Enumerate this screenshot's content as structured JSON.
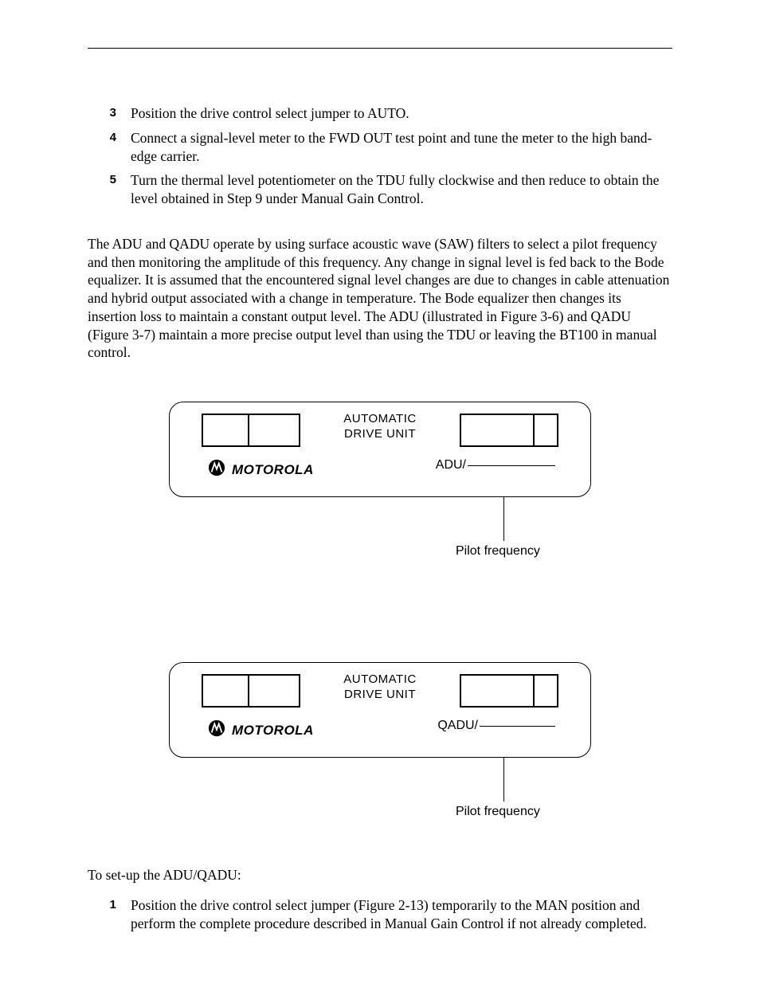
{
  "steps_a": [
    {
      "n": "3",
      "text": "Position the drive control select jumper to AUTO."
    },
    {
      "n": "4",
      "text": "Connect a signal-level meter to the FWD OUT test point and tune the meter to the high band-edge carrier."
    },
    {
      "n": "5",
      "text": "Turn the thermal level potentiometer on the TDU fully clockwise and then reduce to obtain the level obtained in Step 9 under Manual Gain Control."
    }
  ],
  "paragraph": "The ADU and QADU operate by using surface acoustic wave (SAW) filters to select a pilot frequency and then monitoring the amplitude of this frequency. Any change in signal level is fed back to the Bode equalizer. It is assumed that the encountered signal level changes are due to changes in cable attenuation and hybrid output associated with a change in temperature. The Bode equalizer then changes its insertion loss to maintain a constant output level. The ADU (illustrated in Figure 3-6) and QADU (Figure 3-7) maintain a more precise output level than using the TDU or leaving the BT100 in manual control.",
  "diagram": {
    "center1": "AUTOMATIC",
    "center2": "DRIVE UNIT",
    "brand": "MOTOROLA",
    "model_a": "ADU/",
    "model_b": "QADU/",
    "caption": "Pilot frequency"
  },
  "setup_intro": "To set-up the ADU/QADU:",
  "steps_b": [
    {
      "n": "1",
      "text": "Position the drive control select jumper (Figure 2-13) temporarily to the MAN position and perform the complete procedure described in Manual Gain Control if not already completed."
    }
  ]
}
